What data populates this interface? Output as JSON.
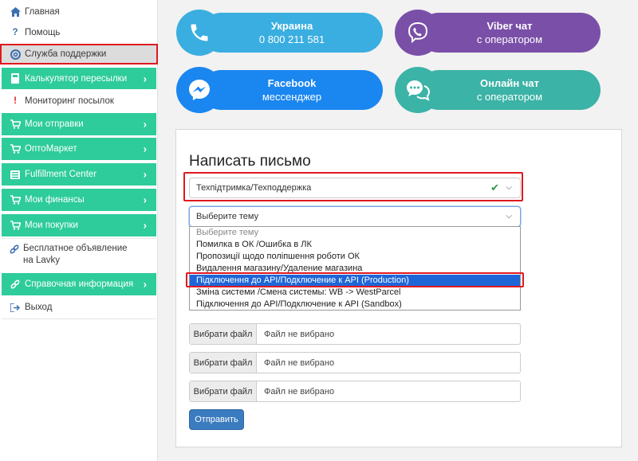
{
  "sidebar": {
    "items": [
      {
        "label": "Главная",
        "icon": "home-icon"
      },
      {
        "label": "Помощь",
        "icon": "question-icon"
      },
      {
        "label": "Служба поддержки",
        "icon": "lifebuoy-icon"
      },
      {
        "label": "Калькулятор пересылки",
        "icon": "calculator-icon"
      },
      {
        "label": "Мониторинг посылок",
        "icon": "exclamation-icon"
      },
      {
        "label": "Мои отправки",
        "icon": "cart-icon"
      },
      {
        "label": "ОптоМаркет",
        "icon": "cart-icon"
      },
      {
        "label": "Fulfillment Center",
        "icon": "list-icon"
      },
      {
        "label": "Мои финансы",
        "icon": "cart-icon"
      },
      {
        "label": "Мои покупки",
        "icon": "cart-icon"
      },
      {
        "label": "Бесплатное объявление на Lavky",
        "icon": "link-icon"
      },
      {
        "label": "Справочная информация",
        "icon": "link-icon"
      },
      {
        "label": "Выход",
        "icon": "logout-icon"
      }
    ]
  },
  "contacts": [
    {
      "title": "Украина",
      "sub": "0 800 211 581",
      "color": "#3aaee0",
      "icon": "phone-icon"
    },
    {
      "title": "Viber чат",
      "sub": "с оператором",
      "color": "#7a4fa8",
      "icon": "viber-icon"
    },
    {
      "title": "Facebook",
      "sub": "мессенджер",
      "color": "#1a86f0",
      "icon": "messenger-icon"
    },
    {
      "title": "Онлайн чат",
      "sub": "с оператором",
      "color": "#3bb3a6",
      "icon": "chat-icon"
    }
  ],
  "form": {
    "title": "Написать письмо",
    "department": "Техпідтримка/Техподдержка",
    "topic_placeholder": "Выберите тему",
    "options": [
      "Выберите тему",
      "Помилка в ОК /Ошибка в ЛК",
      "Пропозиції щодо поліпшення роботи ОК",
      "Видалення магазину/Удаление магазина",
      "Підключення до API/Подключение к API (Production)",
      "Зміна системи /Смена системы: WB -> WestParcel",
      "Підключення до API/Подключение к API (Sandbox)"
    ],
    "selected_option": 4,
    "file_button": "Вибрати файл",
    "file_status": "Файл не вибрано",
    "submit": "Отправить"
  },
  "colors": {
    "sidebar_green": "#2ecc9a",
    "highlight_red": "#e0191f",
    "submit_blue": "#3b7bbf",
    "selected_option_blue": "#1e66d8"
  }
}
